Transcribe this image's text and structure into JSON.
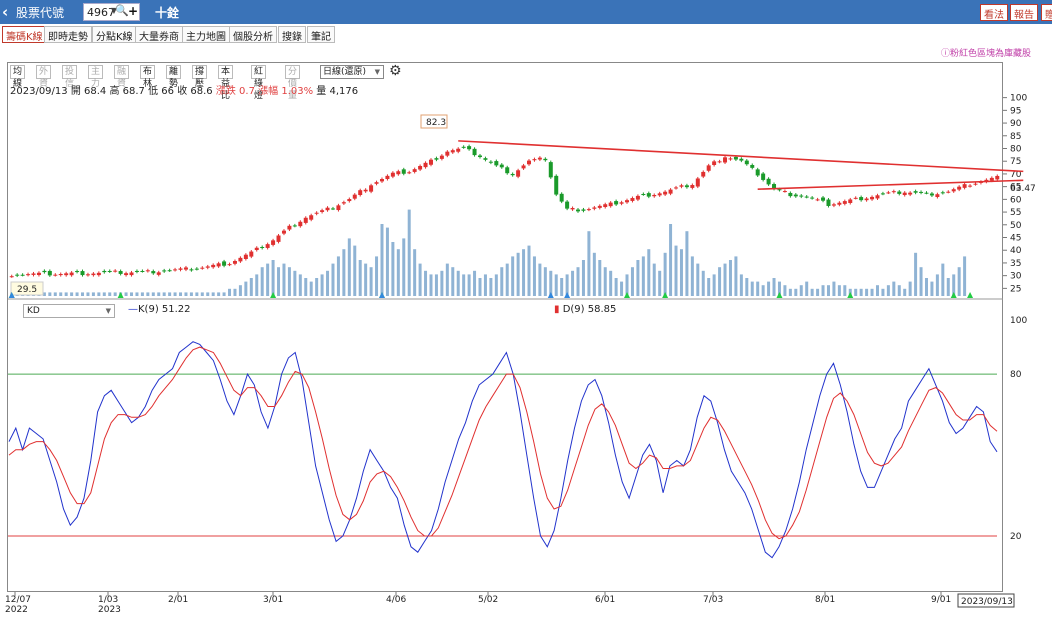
{
  "topbar": {
    "title": "股票代號",
    "code": "4967",
    "stock_name": "十銓",
    "buttons": [
      "看法",
      "報告",
      "贈"
    ],
    "accent": "#3a73b8"
  },
  "tabs": [
    "籌碼K線",
    "即時走勢",
    "分點K線",
    "大量券商",
    "主力地圖",
    "個股分析",
    "搜錄",
    "筆記"
  ],
  "toolbar": {
    "items": [
      {
        "label": "均線",
        "enabled": true
      },
      {
        "label": "外資",
        "enabled": false
      },
      {
        "label": "投信",
        "enabled": false
      },
      {
        "label": "主力",
        "enabled": false
      },
      {
        "label": "融資",
        "enabled": false
      },
      {
        "label": "布林",
        "enabled": true
      },
      {
        "label": "離勢",
        "enabled": true
      },
      {
        "label": "撐壓",
        "enabled": true
      },
      {
        "label": "本益比",
        "enabled": true
      },
      {
        "label": "紅綠燈",
        "enabled": true
      },
      {
        "label": "分價量",
        "enabled": false
      }
    ],
    "range_select": "日線(還原)"
  },
  "note": "ⓘ粉紅色區塊為庫藏股",
  "info": {
    "date": "2023/09/13",
    "open_label": "開",
    "open": "68.4",
    "high_label": "高",
    "high": "68.7",
    "low_label": "低",
    "low": "66",
    "close_label": "收",
    "close": "68.6",
    "change_label": "漲跌",
    "change": "0.7",
    "pct_label": "漲幅",
    "pct": "1.03%",
    "vol_label": "量",
    "vol": "4,176"
  },
  "kd": {
    "selector": "KD",
    "k_label": "K(9) 51.22",
    "d_label": "D(9) 58.85"
  },
  "annotations": {
    "peak_label": "82.3",
    "left_label": "29.5",
    "right_label": "63.47",
    "date_box": "2023/09/13"
  },
  "chart_data": [
    {
      "type": "candlestick",
      "title": "",
      "ylim": [
        22,
        103
      ],
      "yticks": [
        25,
        30,
        35,
        40,
        45,
        50,
        55,
        60,
        65,
        70,
        75,
        80,
        85,
        90,
        95,
        100
      ],
      "x_labels": [
        "12/07\n2022",
        "1/03\n2023",
        "2/01",
        "3/01",
        "4/06",
        "5/02",
        "6/01",
        "7/03",
        "8/01",
        "9/01"
      ],
      "colors": {
        "up": "#e03030",
        "down": "#1a9a2a",
        "volume": "#8fb3d4",
        "trend": "#e03030"
      },
      "close_path": [
        [
          0,
          30.5
        ],
        [
          10,
          30.8
        ],
        [
          18,
          31.2
        ],
        [
          25,
          31.5
        ],
        [
          32,
          32.5
        ],
        [
          36,
          33.5
        ],
        [
          40,
          35
        ],
        [
          44,
          39
        ],
        [
          48,
          44
        ],
        [
          51,
          49
        ],
        [
          54,
          53
        ],
        [
          58,
          56
        ],
        [
          62,
          60
        ],
        [
          66,
          66
        ],
        [
          70,
          70
        ],
        [
          73,
          71
        ],
        [
          77,
          75
        ],
        [
          80,
          79
        ],
        [
          83,
          80
        ],
        [
          86,
          77
        ],
        [
          89,
          73
        ],
        [
          92,
          70
        ],
        [
          95,
          75
        ],
        [
          98,
          76
        ],
        [
          100,
          62
        ],
        [
          102,
          56
        ],
        [
          105,
          56
        ],
        [
          110,
          58
        ],
        [
          115,
          61
        ],
        [
          120,
          63
        ],
        [
          125,
          66
        ],
        [
          128,
          73
        ],
        [
          131,
          77
        ],
        [
          134,
          75
        ],
        [
          137,
          70
        ],
        [
          140,
          64
        ],
        [
          143,
          62
        ],
        [
          146,
          61
        ],
        [
          150,
          58
        ],
        [
          155,
          60
        ],
        [
          160,
          62
        ],
        [
          164,
          63
        ],
        [
          168,
          62
        ],
        [
          172,
          63
        ],
        [
          176,
          66
        ],
        [
          181,
          68.6
        ]
      ],
      "trend_lines": [
        [
          [
            82,
            83
          ],
          [
            181,
            71
          ]
        ],
        [
          [
            137,
            64
          ],
          [
            181,
            67.5
          ]
        ]
      ],
      "volume": [
        1,
        1,
        1,
        1,
        1,
        1,
        1,
        1,
        1,
        1,
        1,
        1,
        1,
        1,
        1,
        1,
        1,
        1,
        1,
        1,
        1,
        1,
        1,
        1,
        1,
        1,
        1,
        1,
        1,
        1,
        1,
        1,
        1,
        1,
        1,
        1,
        1,
        1,
        1,
        1,
        2,
        2,
        3,
        4,
        5,
        6,
        8,
        9,
        10,
        8,
        9,
        8,
        7,
        6,
        5,
        4,
        5,
        6,
        7,
        9,
        11,
        13,
        16,
        14,
        10,
        9,
        8,
        11,
        20,
        19,
        15,
        13,
        16,
        24,
        13,
        9,
        7,
        6,
        6,
        7,
        9,
        8,
        7,
        6,
        6,
        7,
        5,
        6,
        5,
        6,
        8,
        9,
        11,
        12,
        13,
        14,
        11,
        9,
        8,
        7,
        6,
        5,
        6,
        7,
        8,
        10,
        18,
        12,
        10,
        8,
        7,
        5,
        4,
        6,
        8,
        10,
        11,
        13,
        9,
        7,
        12,
        20,
        14,
        13,
        18,
        11,
        9,
        7,
        5,
        6,
        8,
        9,
        10,
        11,
        6,
        5,
        4,
        4,
        3,
        4,
        5,
        4,
        3,
        2,
        2,
        3,
        4,
        2,
        2,
        3,
        3,
        4,
        3,
        3,
        2,
        2,
        2,
        2,
        2,
        3,
        2,
        3,
        4,
        3,
        2,
        4,
        12,
        8,
        5,
        4,
        6,
        9,
        5,
        6,
        8,
        11
      ]
    },
    {
      "type": "line",
      "title": "",
      "ylim": [
        0,
        100
      ],
      "reference_lines": [
        {
          "value": 80,
          "color": "#4caa55"
        },
        {
          "value": 20,
          "color": "#e04040"
        }
      ],
      "yticks_right": [
        20,
        80,
        100
      ],
      "series": [
        {
          "name": "K(9)",
          "color": "#2233cc",
          "values": [
            55,
            60,
            52,
            60,
            58,
            56,
            48,
            40,
            30,
            24,
            27,
            34,
            48,
            66,
            72,
            74,
            70,
            66,
            62,
            64,
            68,
            74,
            78,
            80,
            82,
            88,
            90,
            92,
            91,
            88,
            85,
            78,
            70,
            65,
            72,
            80,
            76,
            66,
            60,
            68,
            80,
            86,
            88,
            78,
            62,
            46,
            36,
            26,
            18,
            20,
            26,
            34,
            44,
            52,
            48,
            44,
            38,
            34,
            24,
            16,
            14,
            18,
            22,
            30,
            40,
            48,
            56,
            62,
            70,
            76,
            78,
            80,
            84,
            88,
            80,
            66,
            50,
            34,
            20,
            16,
            22,
            34,
            48,
            60,
            70,
            76,
            78,
            72,
            62,
            50,
            40,
            34,
            42,
            50,
            54,
            48,
            36,
            46,
            48,
            46,
            52,
            64,
            72,
            70,
            62,
            52,
            44,
            40,
            36,
            30,
            22,
            14,
            12,
            16,
            22,
            30,
            40,
            52,
            62,
            72,
            80,
            84,
            76,
            66,
            54,
            44,
            38,
            38,
            44,
            50,
            56,
            60,
            70,
            74,
            78,
            82,
            76,
            70,
            62,
            58,
            60,
            64,
            68,
            66,
            55,
            51.22
          ]
        },
        {
          "name": "D(9)",
          "color": "#e03030",
          "values": [
            50,
            52,
            52,
            54,
            55,
            55,
            52,
            48,
            42,
            36,
            32,
            32,
            36,
            46,
            56,
            62,
            65,
            65,
            64,
            64,
            65,
            68,
            72,
            75,
            78,
            82,
            86,
            89,
            90,
            89,
            88,
            84,
            79,
            74,
            72,
            75,
            75,
            72,
            68,
            68,
            72,
            77,
            81,
            80,
            75,
            66,
            56,
            45,
            35,
            28,
            26,
            28,
            33,
            40,
            43,
            44,
            42,
            38,
            33,
            27,
            22,
            20,
            20,
            23,
            29,
            35,
            42,
            49,
            56,
            63,
            68,
            72,
            76,
            80,
            80,
            75,
            66,
            55,
            43,
            34,
            30,
            31,
            37,
            45,
            53,
            61,
            67,
            69,
            66,
            61,
            54,
            47,
            45,
            47,
            50,
            49,
            45,
            45,
            46,
            46,
            48,
            54,
            60,
            64,
            63,
            59,
            54,
            49,
            44,
            39,
            33,
            26,
            21,
            19,
            20,
            24,
            29,
            37,
            46,
            55,
            64,
            71,
            73,
            70,
            65,
            58,
            51,
            47,
            46,
            47,
            50,
            53,
            59,
            64,
            69,
            74,
            75,
            73,
            69,
            65,
            63,
            63,
            65,
            65,
            61,
            58.85
          ]
        }
      ]
    }
  ]
}
